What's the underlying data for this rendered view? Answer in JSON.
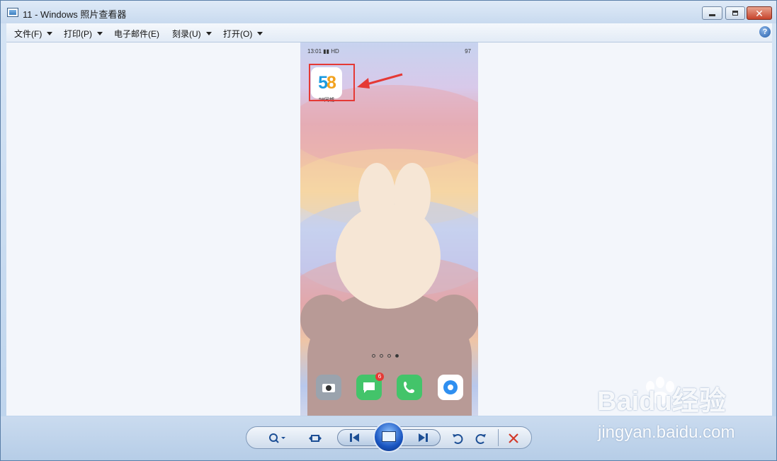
{
  "window": {
    "title": "11 - Windows 照片查看器"
  },
  "menu": [
    {
      "label": "文件(F)",
      "has_dropdown": true
    },
    {
      "label": "打印(P)",
      "has_dropdown": true
    },
    {
      "label": "电子邮件(E)",
      "has_dropdown": false
    },
    {
      "label": "刻录(U)",
      "has_dropdown": true
    },
    {
      "label": "打开(O)",
      "has_dropdown": true
    }
  ],
  "help": {
    "label": "?"
  },
  "phone": {
    "status_time": "13:01",
    "status_signal": "HD",
    "battery": "97",
    "app_label": "58同城",
    "app_digits": {
      "first": "5",
      "second": "8"
    },
    "badge_count": "6",
    "page_dots": 4,
    "active_dot": 4
  },
  "controls": {
    "zoom": "zoom-icon",
    "fit": "actual-size-icon",
    "prev": "previous-icon",
    "slideshow": "slideshow-icon",
    "next": "next-icon",
    "rotate_ccw": "rotate-counterclockwise-icon",
    "rotate_cw": "rotate-clockwise-icon",
    "delete": "delete-icon"
  },
  "watermark": {
    "main": "Bai",
    "du": "du",
    "jy": "经验",
    "sub": "jingyan.baidu.com"
  },
  "colors": {
    "highlight": "#e53935",
    "accent": "#1d4f95"
  }
}
